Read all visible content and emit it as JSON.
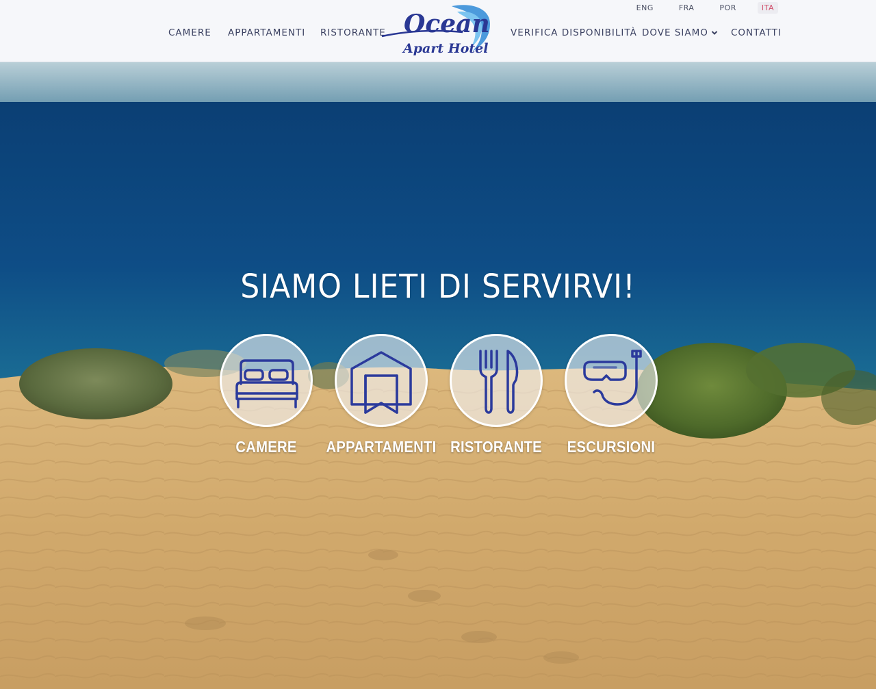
{
  "header": {
    "languages": [
      {
        "code": "ENG"
      },
      {
        "code": "FRA"
      },
      {
        "code": "POR"
      },
      {
        "code": "ITA"
      }
    ],
    "active_language": "ITA",
    "nav_left": [
      {
        "label": "CAMERE"
      },
      {
        "label": "APPARTAMENTI"
      },
      {
        "label": "RISTORANTE"
      }
    ],
    "nav_right": [
      {
        "label": "VERIFICA DISPONIBILITÀ"
      },
      {
        "label": "DOVE SIAMO",
        "icon": "chevron-down-icon"
      },
      {
        "label": "CONTATTI"
      }
    ],
    "logo": {
      "line1": "Ocean",
      "line2": "Apart Hotel"
    }
  },
  "hero": {
    "title": "SIAMO LIETI DI SERVIRVI!",
    "services": [
      {
        "label": "CAMERE",
        "icon": "bed-icon"
      },
      {
        "label": "APPARTAMENTI",
        "icon": "apartment-icon"
      },
      {
        "label": "RISTORANTE",
        "icon": "fork-knife-icon"
      },
      {
        "label": "ESCURSIONI",
        "icon": "snorkel-mask-icon"
      }
    ]
  },
  "colors": {
    "nav_text": "#3c4262",
    "active_language": "#d14e6b",
    "icon_stroke": "#2b3a9c",
    "logo_blue": "#2a3894",
    "sea": "#0e4d86",
    "sand": "#d4ac70"
  }
}
